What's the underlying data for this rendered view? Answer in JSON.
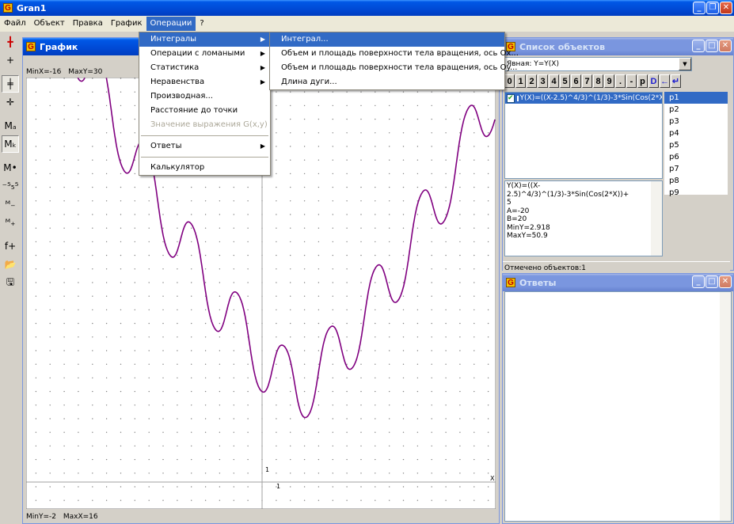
{
  "app": {
    "title": "Gran1"
  },
  "menubar": [
    "Файл",
    "Объект",
    "Правка",
    "График",
    "Операции",
    "?"
  ],
  "toolbar": {
    "icons": [
      {
        "name": "axes-red-icon",
        "glyph": "╋",
        "color": "#cc0000"
      },
      {
        "name": "axes-icon",
        "glyph": "+",
        "color": "#000000"
      },
      {
        "sep": true
      },
      {
        "name": "axes-tick-icon",
        "glyph": "╪",
        "color": "#000000",
        "pressed": true
      },
      {
        "name": "axes-cross-icon",
        "glyph": "✛",
        "color": "#000000"
      },
      {
        "sep": true
      },
      {
        "name": "scale-a-icon",
        "glyph": "Mₐ",
        "color": "#000000"
      },
      {
        "name": "scale-k-icon",
        "glyph": "Mₖ",
        "color": "#000000",
        "pressed": true
      },
      {
        "sep": true
      },
      {
        "name": "mark-point-icon",
        "glyph": "M•",
        "color": "#000000"
      },
      {
        "name": "ticks-icon",
        "glyph": "⁻⁵₅⁵",
        "color": "#000000"
      },
      {
        "name": "zoom-out-icon",
        "glyph": "ᴹ₋",
        "color": "#000000"
      },
      {
        "name": "zoom-in-icon",
        "glyph": "ᴹ₊",
        "color": "#000000"
      },
      {
        "sep": true
      },
      {
        "name": "function-add-icon",
        "glyph": "f+",
        "color": "#000000"
      },
      {
        "name": "open-folder-icon",
        "glyph": "📂",
        "color": "#c08000"
      },
      {
        "name": "save-disk-icon",
        "glyph": "🖫",
        "color": "#000000"
      }
    ]
  },
  "graph": {
    "title": "График",
    "min_x_label": "MinX=-16",
    "max_y_label": "MaxY=30",
    "min_y_label": "MinY=-2",
    "max_x_label": "MaxX=16",
    "axis_y_tick": "1",
    "axis_x_tick": "1",
    "axis_x_name": "X",
    "curve_color": "#800080",
    "x_range": [
      -16,
      16
    ],
    "y_range": [
      -2,
      30
    ]
  },
  "operations_menu": {
    "items": [
      {
        "label": "Интегралы",
        "submenu": true,
        "highlighted": true
      },
      {
        "label": "Операции с ломаными",
        "submenu": true
      },
      {
        "label": "Статистика",
        "submenu": true
      },
      {
        "label": "Неравенства",
        "submenu": true
      },
      {
        "label": "Производная..."
      },
      {
        "label": "Расстояние до точки"
      },
      {
        "label": "Значение выражения G(x,y)",
        "disabled": true
      },
      {
        "sep": true
      },
      {
        "label": "Ответы",
        "submenu": true
      },
      {
        "sep": true
      },
      {
        "label": "Калькулятор"
      }
    ]
  },
  "integrals_submenu": {
    "items": [
      {
        "label": "Интеграл...",
        "highlighted": true
      },
      {
        "label": "Объем и площадь поверхности тела вращения, ось Ox..."
      },
      {
        "label": "Объем и площадь поверхности тела вращения, ось Oy..."
      },
      {
        "label": "Длина дуги..."
      }
    ]
  },
  "objects_panel": {
    "title": "Список объектов",
    "type_select": "Явная: Y=Y(X)",
    "digit_buttons": [
      "0",
      "1",
      "2",
      "3",
      "4",
      "5",
      "6",
      "7",
      "8",
      "9",
      ".",
      "-",
      "p",
      "D",
      "←",
      "↵"
    ],
    "object_entry": "Y(X)=((X-2.5)^4/3)^(1/3)-3*Sin(Cos(2*X))+5",
    "object_checked": true,
    "points": [
      "p1",
      "p2",
      "p3",
      "p4",
      "p5",
      "p6",
      "p7",
      "p8",
      "p9"
    ],
    "info_lines": [
      "Y(X)=((X-2.5)^4/3)^(1/3)-3*Sin(Cos(2*X))+",
      "5",
      "A=-20",
      "B=20",
      "MinY=2.918",
      "MaxY=50.9"
    ],
    "status": "Отмечено объектов:1"
  },
  "answers_panel": {
    "title": "Ответы"
  }
}
